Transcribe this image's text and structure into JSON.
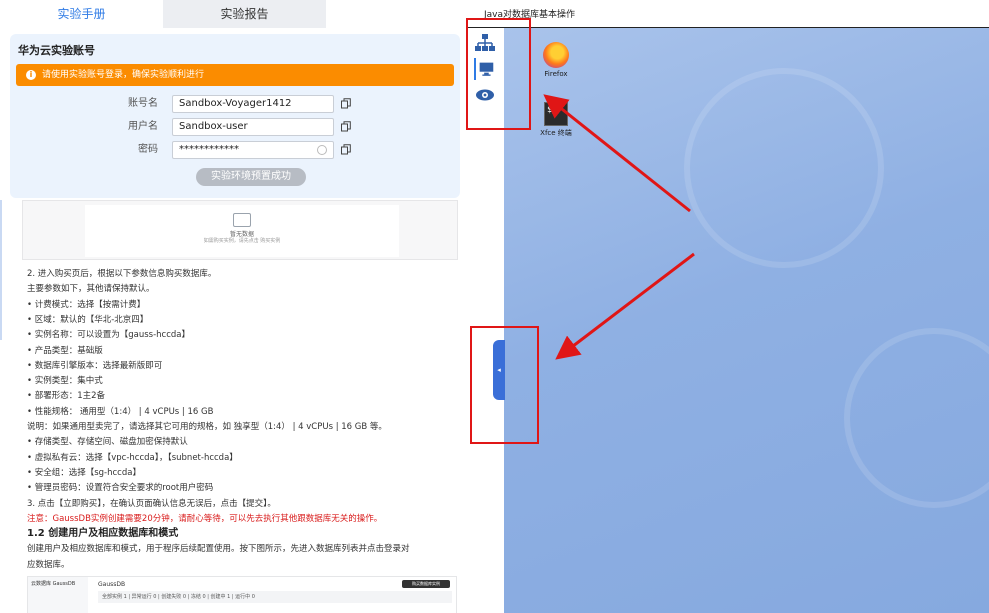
{
  "tabs": [
    {
      "label": "实验手册",
      "active": true
    },
    {
      "label": "实验报告",
      "active": false
    }
  ],
  "account": {
    "title": "华为云实验账号",
    "warning": "请使用实验账号登录，确保实验顺利进行",
    "fields": [
      {
        "label": "账号名",
        "value": "Sandbox-Voyager1412"
      },
      {
        "label": "用户名",
        "value": "Sandbox-user"
      },
      {
        "label": "密码",
        "value": "************"
      }
    ],
    "ready_button": "实验环境预置成功"
  },
  "doc_image": {
    "caption": "暂无数据",
    "subcaption": "如需购买实例，请先点击 购买实例"
  },
  "doc": {
    "lines": [
      {
        "text": "2. 进入购买页后，根据以下参数信息购买数据库。",
        "style": "normal"
      },
      {
        "text": "   主要参数如下，其他请保持默认。",
        "style": "normal"
      },
      {
        "text": "• 计费模式：选择【按需计费】",
        "style": "normal"
      },
      {
        "text": "• 区域：默认的【华北-北京四】",
        "style": "normal"
      },
      {
        "text": "• 实例名称：可以设置为【gauss-hccda】",
        "style": "normal"
      },
      {
        "text": "• 产品类型：基础版",
        "style": "normal"
      },
      {
        "text": "• 数据库引擎版本：选择最新版即可",
        "style": "normal"
      },
      {
        "text": "• 实例类型：集中式",
        "style": "normal"
      },
      {
        "text": "• 部署形态：1主2备",
        "style": "normal"
      },
      {
        "text": "• 性能规格：  通用型（1:4） | 4 vCPUs | 16 GB",
        "style": "normal"
      },
      {
        "text": "   说明：如果通用型卖完了，请选择其它可用的规格，如 独享型（1:4） | 4 vCPUs | 16 GB 等。",
        "style": "normal"
      },
      {
        "text": "• 存储类型、存储空间、磁盘加密保持默认",
        "style": "normal"
      },
      {
        "text": "• 虚拟私有云：选择【vpc-hccda】，【subnet-hccda】",
        "style": "normal"
      },
      {
        "text": "• 安全组：选择【sg-hccda】",
        "style": "normal"
      },
      {
        "text": "• 管理员密码：设置符合安全要求的root用户密码",
        "style": "normal"
      },
      {
        "text": "3. 点击【立即购买】，在确认页面确认信息无误后，点击【提交】。",
        "style": "normal"
      },
      {
        "text": "注意：GaussDB实例创建需要20分钟，请耐心等待，可以先去执行其他跟数据库无关的操作。",
        "style": "red"
      },
      {
        "text": "1.2 创建用户及相应数据库和模式",
        "style": "head"
      },
      {
        "text": "创建用户及相应数据库和模式，用于程序后续配置使用。按下图所示，先进入数据库列表并点击登录对",
        "style": "normal"
      },
      {
        "text": "应数据库。",
        "style": "normal"
      }
    ]
  },
  "gauss_shot": {
    "side": "云数据库 GaussDB",
    "title": "GaussDB",
    "buy": "购买数据库实例",
    "stats": "全部实例  1   |  异常运行  0   |  创建失败  0   |  冻结  0   |  创建中  1   |  运行中  0"
  },
  "right": {
    "title": "Java对数据库基本操作",
    "desktop_icons": [
      {
        "name": "firefox",
        "label": "Firefox"
      },
      {
        "name": "terminal",
        "label": "Xfce 终端"
      }
    ]
  },
  "colors": {
    "accent": "#2f7be5",
    "warning": "#fb8c00",
    "highlight": "#e01616",
    "desktop": "#8fb0e3"
  }
}
